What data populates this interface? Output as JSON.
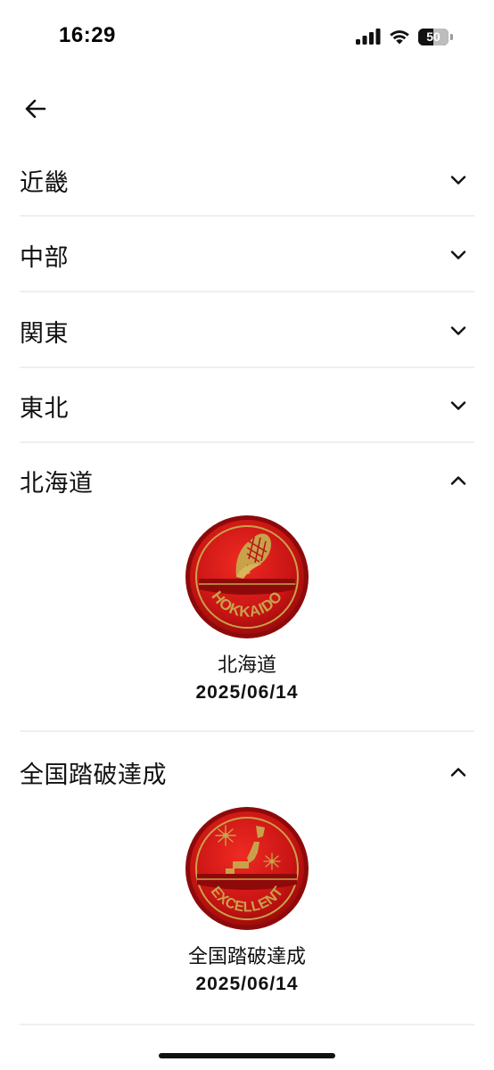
{
  "status_bar": {
    "time": "16:29",
    "battery": "50",
    "battery_level_percent": 50
  },
  "colors": {
    "badge_red": "#d71a1a",
    "badge_dark_red": "#8e0a0a",
    "badge_gold": "#c8a24a",
    "divider": "#efefef"
  },
  "sections": [
    {
      "label": "近畿",
      "expanded": false
    },
    {
      "label": "中部",
      "expanded": false
    },
    {
      "label": "関東",
      "expanded": false
    },
    {
      "label": "東北",
      "expanded": false
    },
    {
      "label": "北海道",
      "expanded": true,
      "badge": {
        "icon": "corn-icon",
        "emblem_text": "HOKKAIDO",
        "name": "北海道",
        "date": "2025/06/14"
      }
    },
    {
      "label": "全国踏破達成",
      "expanded": true,
      "badge": {
        "icon": "japan-map-fireworks-icon",
        "emblem_text": "EXCELLENT",
        "name": "全国踏破達成",
        "date": "2025/06/14"
      }
    }
  ]
}
